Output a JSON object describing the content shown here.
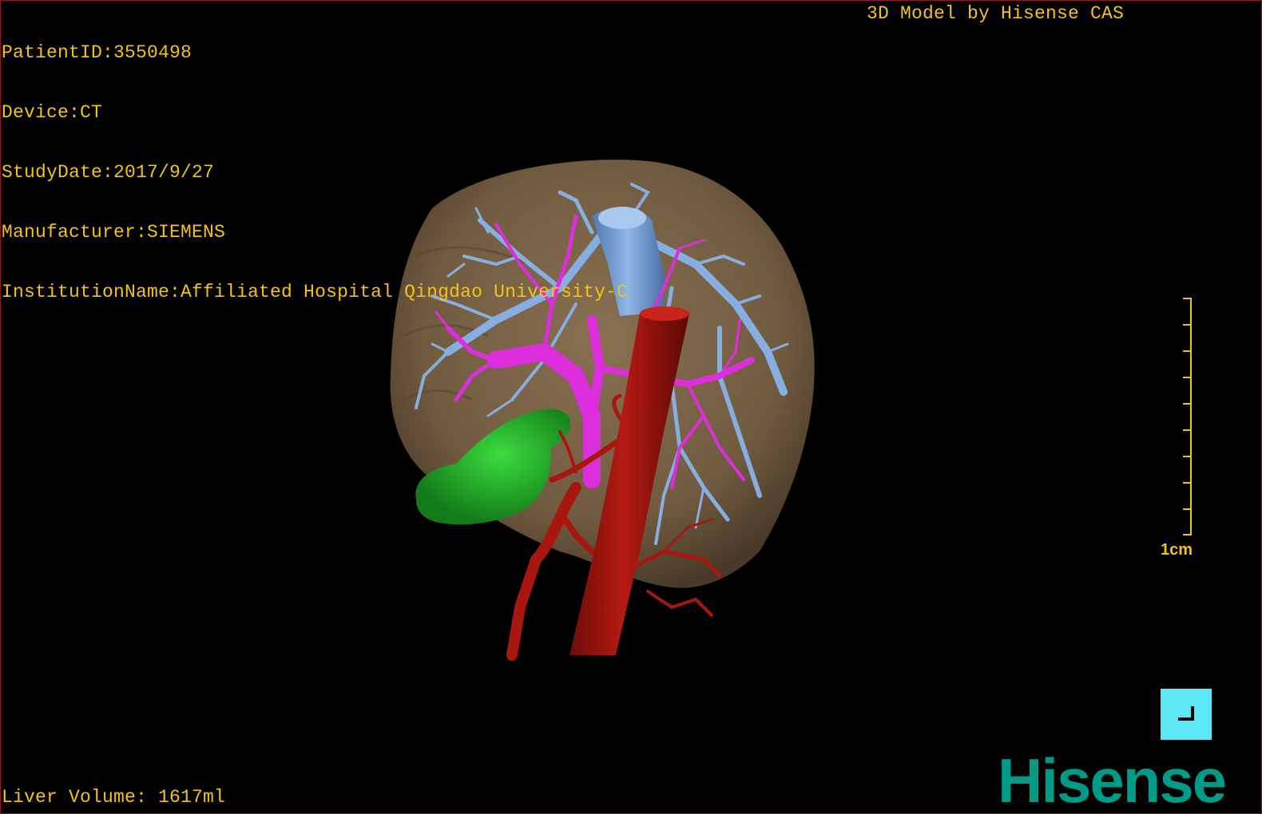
{
  "study_info": {
    "patient_id": "PatientID:3550498",
    "device": "Device:CT",
    "study_date": "StudyDate:2017/9/27",
    "manufacturer": "Manufacturer:SIEMENS",
    "institution": "InstitutionName:Affiliated Hospital Qingdao University-C"
  },
  "brand_credit": "3D Model by Hisense CAS",
  "liver_volume": "Liver Volume: 1617ml",
  "scale_bar": {
    "label": "1cm"
  },
  "logo": {
    "text": "Hisense"
  },
  "icons": {
    "corner_button": "corner-bracket-icon"
  },
  "colors": {
    "overlay_text": "#f2c21a",
    "liver": "#7a6346",
    "hepatic_vein": "#7fa8dc",
    "portal_vein": "#e02ee0",
    "artery": "#a3150f",
    "gallbladder": "#1fb32a",
    "button": "#5de7f4",
    "logo": "#009a87",
    "border": "#8a1a22"
  }
}
